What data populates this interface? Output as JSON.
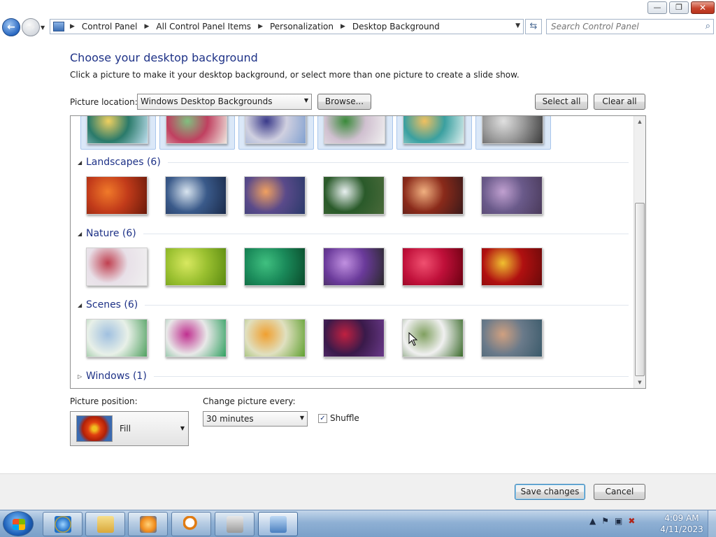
{
  "window": {
    "minimize_glyph": "—",
    "maximize_glyph": "❐",
    "close_glyph": "✕"
  },
  "nav": {
    "back_icon": "back-arrow-icon",
    "forward_icon": "forward-arrow-icon",
    "back_glyph": "←",
    "forward_glyph": "→",
    "breadcrumbs": [
      "Control Panel",
      "All Control Panel Items",
      "Personalization",
      "Desktop Background"
    ],
    "search_placeholder": "Search Control Panel"
  },
  "page": {
    "heading": "Choose your desktop background",
    "subtext": "Click a picture to make it your desktop background, or select more than one picture to create a slide show.",
    "picture_location_label": "Picture location:",
    "picture_location_value": "Windows Desktop Backgrounds",
    "browse_label": "Browse...",
    "select_all_label": "Select all",
    "clear_all_label": "Clear all"
  },
  "gallery": {
    "top_row_selected": true,
    "groups": [
      {
        "name": "Landscapes (6)",
        "expanded": true,
        "colors": [
          [
            "#c23b1a",
            "#f07a2a",
            "#6a1a0a"
          ],
          [
            "#3a5a8a",
            "#d8e4ef",
            "#1a2a4a"
          ],
          [
            "#5a4a8a",
            "#f0a060",
            "#2a3a6a"
          ],
          [
            "#2a5a2a",
            "#e8f0f0",
            "#4a6a3a"
          ],
          [
            "#8a2a1a",
            "#f0b080",
            "#3a1a1a"
          ],
          [
            "#6a5a8a",
            "#c0a0d0",
            "#4a3a5a"
          ]
        ]
      },
      {
        "name": "Nature (6)",
        "expanded": true,
        "colors": [
          [
            "#e8e0e8",
            "#c04050",
            "#f0f0f0"
          ],
          [
            "#9ac030",
            "#d8e860",
            "#5a8a10"
          ],
          [
            "#1a8a5a",
            "#40c080",
            "#0a4a2a"
          ],
          [
            "#6a3a9a",
            "#c090e0",
            "#2a2a2a"
          ],
          [
            "#c0103a",
            "#f05070",
            "#6a0010"
          ],
          [
            "#b01010",
            "#f0c030",
            "#6a0a0a"
          ]
        ]
      },
      {
        "name": "Scenes (6)",
        "expanded": true,
        "colors": [
          [
            "#e8f0e8",
            "#a0c0e0",
            "#50a060"
          ],
          [
            "#e8e8e8",
            "#c03090",
            "#30a060"
          ],
          [
            "#e0e0c0",
            "#f0a030",
            "#60a030"
          ],
          [
            "#3a1a4a",
            "#c02040",
            "#6a3a8a"
          ],
          [
            "#f0f0f0",
            "#80a060",
            "#3a6a2a"
          ],
          [
            "#6a7a8a",
            "#d0a080",
            "#3a5a6a"
          ]
        ]
      },
      {
        "name": "Windows (1)",
        "expanded": false,
        "colors": []
      }
    ],
    "top_row_colors": [
      [
        "#2a7a6a",
        "#f0d060",
        "#c0e0f0"
      ],
      [
        "#c04060",
        "#80c080",
        "#f0e8e0"
      ],
      [
        "#d0d0e0",
        "#3a3a8a",
        "#80a0d0"
      ],
      [
        "#d0c0d0",
        "#3a8a3a",
        "#f0f0f0"
      ],
      [
        "#3aa0a0",
        "#f0c060",
        "#e0f0f0"
      ],
      [
        "#9a9a9a",
        "#e0e0e0",
        "#3a3a3a"
      ]
    ]
  },
  "settings": {
    "picture_position_label": "Picture position:",
    "picture_position_value": "Fill",
    "change_every_label": "Change picture every:",
    "change_every_value": "30 minutes",
    "shuffle_label": "Shuffle",
    "shuffle_checked": true
  },
  "footer": {
    "save_label": "Save changes",
    "cancel_label": "Cancel"
  },
  "taskbar": {
    "items": [
      {
        "name": "internet-explorer",
        "icon": "ie-icon"
      },
      {
        "name": "windows-explorer",
        "icon": "folder-icon"
      },
      {
        "name": "media-player",
        "icon": "media-player-icon"
      },
      {
        "name": "search",
        "icon": "magnifier-icon"
      },
      {
        "name": "printer",
        "icon": "printer-icon"
      },
      {
        "name": "control-panel",
        "icon": "control-panel-icon",
        "active": true
      }
    ],
    "time": "4:09 AM",
    "date": "4/11/2023"
  }
}
